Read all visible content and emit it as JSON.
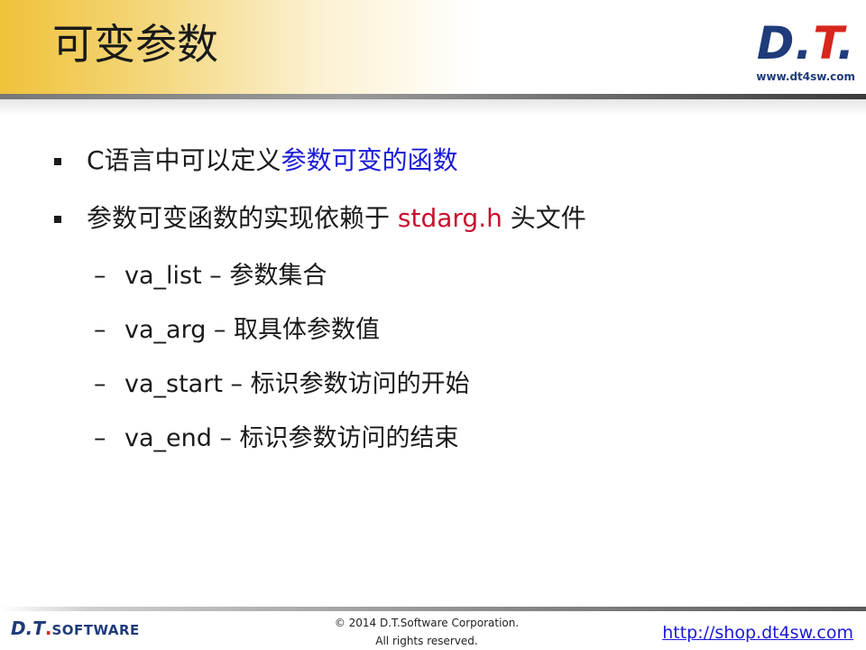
{
  "slide": {
    "title": "可变参数",
    "logo": {
      "mark_main": "D",
      "mark_dot": ".",
      "mark_t": "T",
      "mark_dot2": ".",
      "url": "www.dt4sw.com"
    },
    "bullets": [
      {
        "prefix": "C语言中可以定义",
        "highlight": "参数可变的函数",
        "suffix": ""
      },
      {
        "prefix": "参数可变函数的实现依赖于 ",
        "highlight": "stdarg.h",
        "suffix": " 头文件"
      }
    ],
    "subitems": [
      {
        "dash": "–",
        "text": "va_list – 参数集合"
      },
      {
        "dash": "–",
        "text": "va_arg – 取具体参数值"
      },
      {
        "dash": "–",
        "text": "va_start – 标识参数访问的开始"
      },
      {
        "dash": "–",
        "text": "va_end – 标识参数访问的结束"
      }
    ],
    "footer": {
      "logo_dt": "D.T",
      "logo_dot": ".",
      "logo_software": "SOFTWARE",
      "copyright_line1": "© 2014 D.T.Software Corporation.",
      "copyright_line2": "All rights reserved.",
      "link": "http://shop.dt4sw.com"
    },
    "colors": {
      "accent_gold": "#f0c23a",
      "brand_blue": "#1f3b7a",
      "brand_red": "#d7261e",
      "highlight_blue": "#1a1ad8",
      "highlight_red": "#c8102e"
    }
  }
}
